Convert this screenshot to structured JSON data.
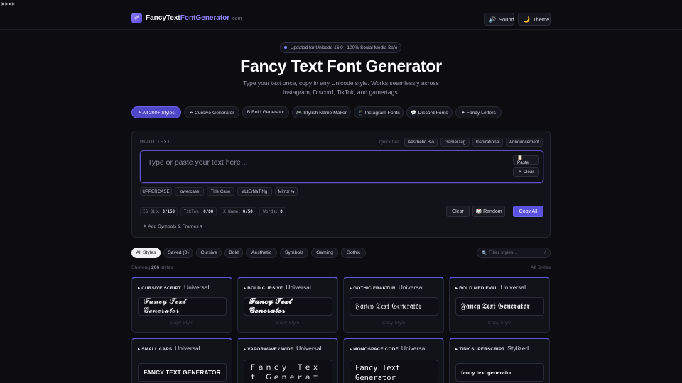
{
  "corner": ">>>>",
  "brand": {
    "name": "FancyText",
    "accent": "FontGenerator",
    "tld": ".com",
    "logo_glyph": "✐"
  },
  "nav": {
    "sound": "Sound",
    "theme": "Theme",
    "sound_icon": "speaker-icon",
    "theme_icon": "moon-icon"
  },
  "hero": {
    "badge": "Updated for Unicode 16.0 · 100% Social Media Safe",
    "title": "Fancy Text Font Generator",
    "subtitle": "Type your text once, copy in any Unicode style. Works seamlessly across Instagram, Discord, TikTok, and gamertags."
  },
  "categories": [
    {
      "label": "⚡ All 200+ Styles",
      "active": true
    },
    {
      "label": "✒ Cursive Generator"
    },
    {
      "label": "B Bold Generator"
    },
    {
      "label": "🎮 Stylish Name Maker"
    },
    {
      "label": "📱 Instagram Fonts"
    },
    {
      "label": "💬 Discord Fonts"
    },
    {
      "label": "✦ Fancy Letters"
    }
  ],
  "input": {
    "label": "INPUT TEXT",
    "quick_label": "Quick test:",
    "quick": [
      "Aesthetic Bio",
      "GamerTag",
      "Inspirational",
      "Announcement"
    ],
    "placeholder": "Type or paste your text here…",
    "paste": "📋 Paste",
    "clear_small": "✕ Clear",
    "cases": [
      "UPPERCASE",
      "lowercase",
      "Title Case",
      "aLtErNaTiNg",
      "Mirror ⇆"
    ],
    "stats": [
      {
        "label": "IG Bio:",
        "value": "0/150"
      },
      {
        "label": "TikTok:",
        "value": "0/80"
      },
      {
        "label": "X Name:",
        "value": "0/50"
      },
      {
        "label": "Words:",
        "value": "0"
      }
    ],
    "clear": "Clear",
    "random": "🎲 Random",
    "copy_all": "Copy All",
    "symbols": "✦  Add Symbols & Frames  ▾"
  },
  "filters": [
    "All Styles",
    "Saved (0)",
    "Cursive",
    "Bold",
    "Aesthetic",
    "Symbols",
    "Gaming",
    "Gothic"
  ],
  "search": {
    "placeholder": "Filter styles...",
    "shortcut": "/"
  },
  "showing": {
    "prefix": "Showing",
    "count": "206",
    "suffix": "styles",
    "right": "All Styles"
  },
  "cards": [
    {
      "name": "▸ CURSIVE SCRIPT",
      "tag": "Universal",
      "preview": "𝓕𝓪𝓷𝓬𝔂 𝓣𝓮𝔁𝓽 𝓖𝓮𝓷𝓮𝓻𝓪𝓽𝓸𝓻",
      "copy": "Copy Style"
    },
    {
      "name": "▸ BOLD CURSIVE",
      "tag": "Universal",
      "preview": "𝓕𝓪𝓷𝓬𝔂 𝓣𝓮𝔁𝓽 𝓖𝓮𝓷𝓮𝓻𝓪𝓽𝓸𝓻",
      "copy": "Copy Style"
    },
    {
      "name": "▸ GOTHIC FRAKTUR",
      "tag": "Universal",
      "preview": "𝔉𝔞𝔫𝔠𝔶 𝔗𝔢𝔵𝔱 𝔊𝔢𝔫𝔢𝔯𝔞𝔱𝔬𝔯",
      "copy": "Copy Style"
    },
    {
      "name": "▸ BOLD MEDIEVAL",
      "tag": "Universal",
      "preview": "𝕱𝖆𝖓𝖈𝖞 𝕿𝖊𝖝𝖙 𝕲𝖊𝖓𝖊𝖗𝖆𝖙𝖔𝖗",
      "copy": "Copy Style"
    },
    {
      "name": "▸ SMALL CAPS",
      "tag": "Universal",
      "preview": "FANCY TEXT GENERATOR"
    },
    {
      "name": "▸ VAPORWAVE / WIDE",
      "tag": "Universal",
      "preview": "Ｆａｎｃｙ　Ｔｅｘｔ　Ｇｅｎｅｒａｔｏｒ"
    },
    {
      "name": "▸ MONOSPACE CODE",
      "tag": "Universal",
      "preview": "𝙵𝚊𝚗𝚌𝚢 𝚃𝚎𝚡𝚝 𝙶𝚎𝚗𝚎𝚛𝚊𝚝𝚘𝚛"
    },
    {
      "name": "▸ TINY SUPERSCRIPT",
      "tag": "Stylized",
      "preview": "fancy text generator"
    }
  ]
}
